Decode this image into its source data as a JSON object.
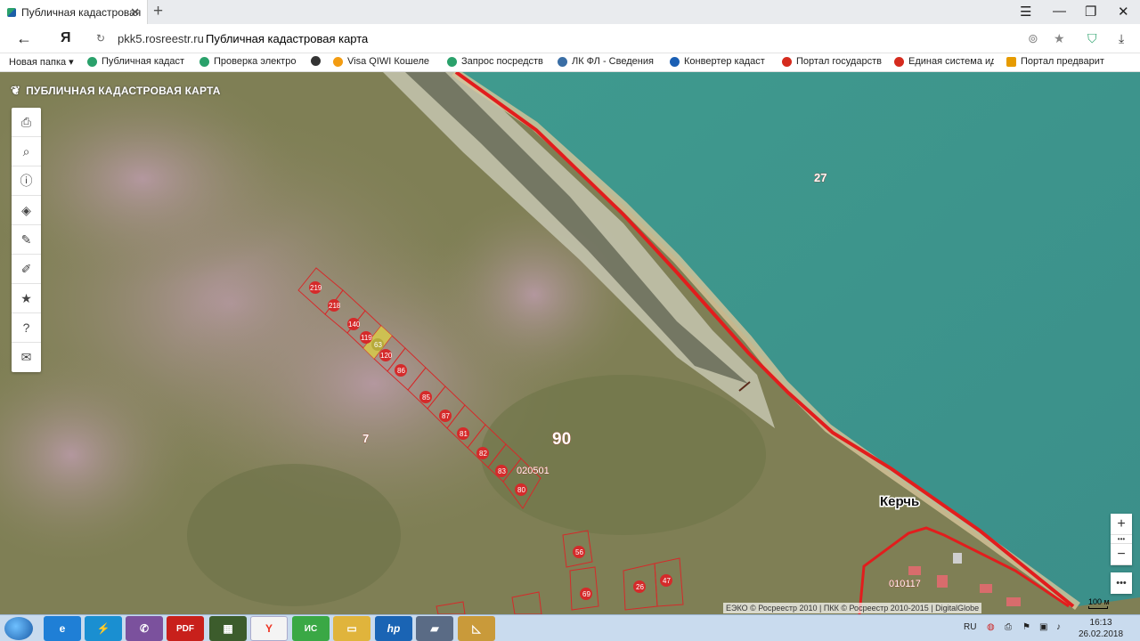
{
  "browser": {
    "tab_title": "Публичная кадастровая",
    "new_tab": "+",
    "close_tab": "✕",
    "window_controls": [
      "☰",
      "—",
      "❐",
      "✕"
    ],
    "back": "←",
    "logo_letter": "Я",
    "domain": "pkk5.rosreestr.ru",
    "page_title": "Публичная кадастровая карта",
    "bookmarks": [
      {
        "label": "Новая папка ▾",
        "icon": "folder-icon"
      },
      {
        "label": "Публичная кадаст",
        "icon": "rosreestr-icon",
        "color": "#2aa16b"
      },
      {
        "label": "Проверка электро",
        "icon": "rosreestr-icon",
        "color": "#2aa16b"
      },
      {
        "label": "",
        "icon": "dark-circle-icon",
        "color": "#333333"
      },
      {
        "label": "Visa QIWI Кошеле",
        "icon": "qiwi-icon",
        "color": "#f39c12"
      },
      {
        "label": "Запрос посредств",
        "icon": "rosreestr-icon",
        "color": "#2aa16b"
      },
      {
        "label": "ЛК ФЛ - Сведения",
        "icon": "fns-icon",
        "color": "#3a6ea5"
      },
      {
        "label": "Конвертер кадаст",
        "icon": "diamond-icon",
        "color": "#1a5fb4"
      },
      {
        "label": "Портал государств",
        "icon": "flag-icon",
        "color": "#d52b1e"
      },
      {
        "label": "Единая система ид",
        "icon": "flag-icon",
        "color": "#d52b1e"
      },
      {
        "label": "Портал предварит",
        "icon": "e-icon",
        "color": "#e69b00"
      }
    ]
  },
  "map": {
    "title": "ПУБЛИЧНАЯ КАДАСТРОВАЯ КАРТА",
    "tools": [
      {
        "name": "print-icon",
        "glyph": "⎙"
      },
      {
        "name": "search-icon",
        "glyph": "⌕"
      },
      {
        "name": "info-icon",
        "glyph": "ⓘ"
      },
      {
        "name": "layers-icon",
        "glyph": "◈"
      },
      {
        "name": "pencil-icon",
        "glyph": "✎"
      },
      {
        "name": "measure-icon",
        "glyph": "✐"
      },
      {
        "name": "star-icon",
        "glyph": "★"
      },
      {
        "name": "help-icon",
        "glyph": "?"
      },
      {
        "name": "mail-icon",
        "glyph": "✉"
      }
    ],
    "zoom_in": "+",
    "zoom_dots": "•••",
    "zoom_out": "−",
    "more": "•••",
    "labels": {
      "quarter_27": "27",
      "quarter_7": "7",
      "quarter_90": "90",
      "block_020501": "020501",
      "city": "Керчь",
      "block_010117": "010117"
    },
    "parcels": [
      "219",
      "218",
      "140",
      "119",
      "63",
      "120",
      "86",
      "85",
      "87",
      "81",
      "82",
      "83",
      "80",
      "56",
      "69",
      "26",
      "47"
    ],
    "attribution": "ЕЭКО © Росреестр 2010 | ПКК © Росреестр 2010-2015 | DigitalGlobe",
    "scale": "100 м"
  },
  "taskbar": {
    "apps": [
      {
        "name": "ie-icon",
        "label": "e",
        "color": "#1f7fd6"
      },
      {
        "name": "lightning-icon",
        "label": "⚡",
        "color": "#1a8fd1"
      },
      {
        "name": "viber-icon",
        "label": "✆",
        "color": "#7b519d"
      },
      {
        "name": "pdf-icon",
        "label": "PDF",
        "color": "#c8201b"
      },
      {
        "name": "game-icon",
        "label": "▦",
        "color": "#3c5c2c"
      },
      {
        "name": "yandex-browser-icon",
        "label": "Y",
        "color": "#e32"
      },
      {
        "name": "ic-icon",
        "label": "ИС",
        "color": "#3aa845"
      },
      {
        "name": "folder-icon",
        "label": "▭",
        "color": "#e0b43c"
      },
      {
        "name": "hp-icon",
        "label": "hp",
        "color": "#1a64b4"
      },
      {
        "name": "scanner-icon",
        "label": "▰",
        "color": "#5a6b85"
      },
      {
        "name": "ruler-icon",
        "label": "◺",
        "color": "#c99a3a"
      }
    ],
    "lang": "RU",
    "time": "16:13",
    "date": "26.02.2018"
  }
}
